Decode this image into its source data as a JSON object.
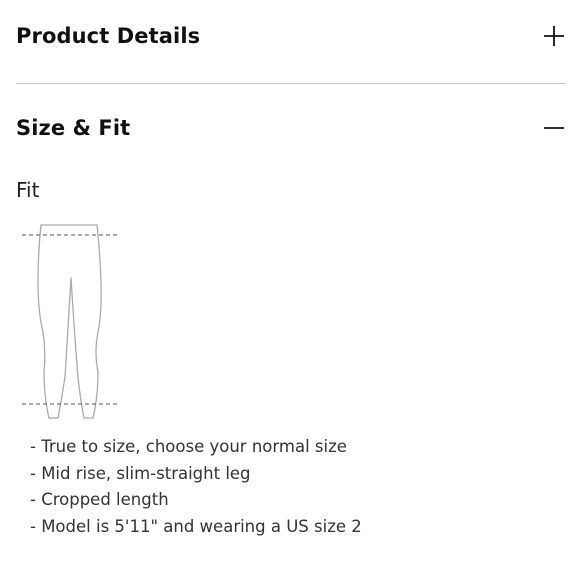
{
  "sections": {
    "product_details": {
      "title": "Product Details",
      "toggle_icon": "plus-icon",
      "expanded": false
    },
    "size_fit": {
      "title": "Size & Fit",
      "toggle_icon": "minus-icon",
      "expanded": true
    }
  },
  "fit": {
    "subtitle": "Fit",
    "diagram_icon": "leggings-fit-diagram-icon",
    "details": [
      "- True to size, choose your normal size",
      "- Mid rise, slim-straight leg",
      "- Cropped length",
      "- Model is 5'11\" and wearing a US size 2"
    ]
  },
  "colors": {
    "text": "#111111",
    "divider": "#c8c8c8",
    "diagram_stroke": "#aaaaaa",
    "dashed_line": "#555555"
  }
}
